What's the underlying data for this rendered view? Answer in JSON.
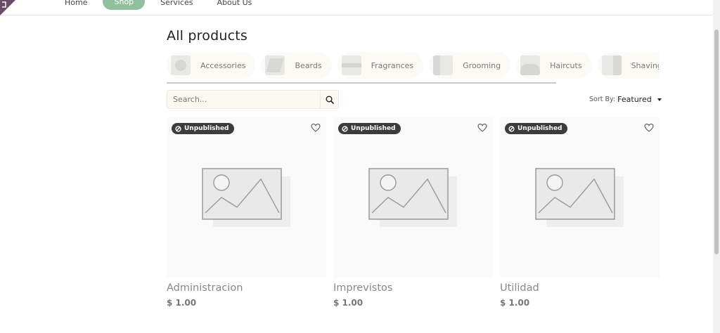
{
  "nav": {
    "items": [
      {
        "label": "Home",
        "active": false
      },
      {
        "label": "Shop",
        "active": true
      },
      {
        "label": "Services",
        "active": false
      },
      {
        "label": "About Us",
        "active": false
      }
    ]
  },
  "page": {
    "title": "All products"
  },
  "categories": [
    {
      "label": "Accessories"
    },
    {
      "label": "Beards"
    },
    {
      "label": "Fragrances"
    },
    {
      "label": "Grooming"
    },
    {
      "label": "Haircuts"
    },
    {
      "label": "Shaving"
    },
    {
      "label": ""
    }
  ],
  "search": {
    "placeholder": "Search..."
  },
  "sort": {
    "label": "Sort By:",
    "value": "Featured"
  },
  "products": [
    {
      "badge": "Unpublished",
      "name": "Administracion",
      "price": "$ 1.00"
    },
    {
      "badge": "Unpublished",
      "name": "Imprevistos",
      "price": "$ 1.00"
    },
    {
      "badge": "Unpublished",
      "name": "Utilidad",
      "price": "$ 1.00"
    }
  ],
  "colors": {
    "accent": "#8fbf9c",
    "badge_bg": "#3c3c3c",
    "corner": "#6b4a66"
  },
  "icons": {
    "search": "search-icon",
    "heart": "heart-icon",
    "badge": "ban-icon"
  }
}
